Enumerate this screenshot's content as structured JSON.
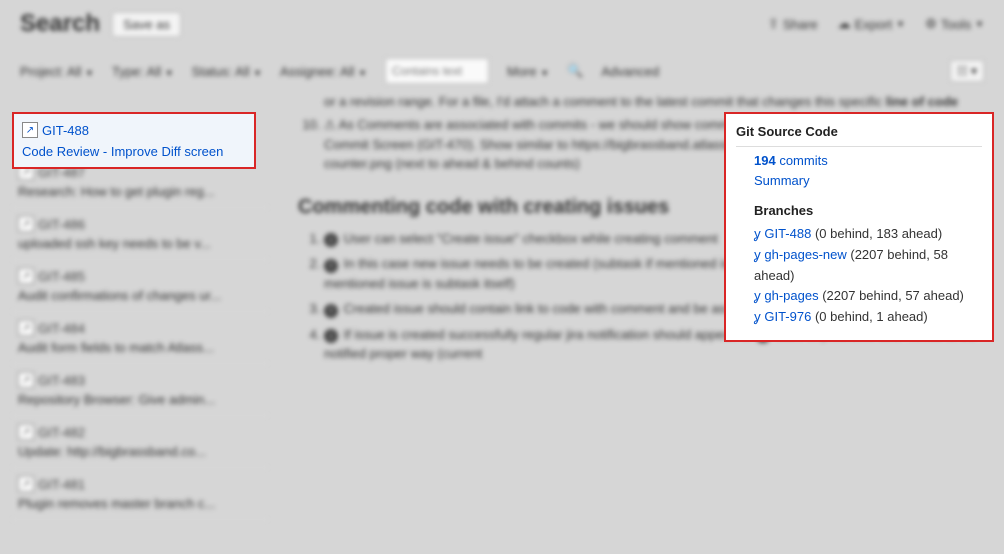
{
  "header": {
    "search": "Search",
    "saveas": "Save as",
    "share": "Share",
    "export": "Export",
    "tools": "Tools"
  },
  "filters": {
    "project": "Project: All",
    "type": "Type: All",
    "status": "Status: All",
    "assignee": "Assignee: All",
    "contains_placeholder": "Contains text",
    "more": "More",
    "advanced": "Advanced"
  },
  "selected_issue": {
    "key": "GIT-488",
    "summary": "Code Review - Improve Diff screen"
  },
  "sidebar_items": [
    {
      "key": "GIT-487",
      "sum": "Research: How to get plugin reg..."
    },
    {
      "key": "GIT-486",
      "sum": "uploaded ssh key needs to be v..."
    },
    {
      "key": "GIT-485",
      "sum": "Audit confirmations of changes ur..."
    },
    {
      "key": "GIT-484",
      "sum": "Audit form fields to match Atlass..."
    },
    {
      "key": "GIT-483",
      "sum": "Repository Browser: Give admin..."
    },
    {
      "key": "GIT-482",
      "sum": "Update: http://bigbrassband.co..."
    },
    {
      "key": "GIT-481",
      "sum": "Plugin removes master branch c..."
    }
  ],
  "main": {
    "frag1": "or a revision range. For a file, I'd attach a comment to the latest commit that changes this specific",
    "frag1b": "line of code",
    "li10a": "As Comments are associated with commits - we should show comments in the new Commits screen and Single Commit Screen (GIT-470). Show similar to https://bigbrassband.atlassian.net/secure/attachment/24172/comment-counter.png (next to ahead & behind counts)",
    "h2": "Commenting code with creating issues",
    "b1": "User can select \"Create issue\" checkbox while creating comment",
    "b2": "In this case new issue needs to be created (subtask if mentioned issue is regular ticket and 'sibling' subtask if mentioned issue is subtask itself)",
    "b3": "Created issue should contain link to code with comment and be assigned to the author of commit",
    "b4a": "If issue is created successfully regular jira notification should appear. In",
    "b4b": "case of problems user needs to be notified proper way (current"
  },
  "git_panel": {
    "title": "Git Source Code",
    "commits_count": "194",
    "commits_label": "commits",
    "summary": "Summary",
    "branches_heading": "Branches",
    "branches": [
      {
        "name": "GIT-488",
        "stat": "(0 behind, 183 ahead)"
      },
      {
        "name": "gh-pages-new",
        "stat": "(2207 behind, 58 ahead)"
      },
      {
        "name": "gh-pages",
        "stat": "(2207 behind, 57 ahead)"
      },
      {
        "name": "GIT-976",
        "stat": "(0 behind, 1 ahead)"
      }
    ]
  }
}
